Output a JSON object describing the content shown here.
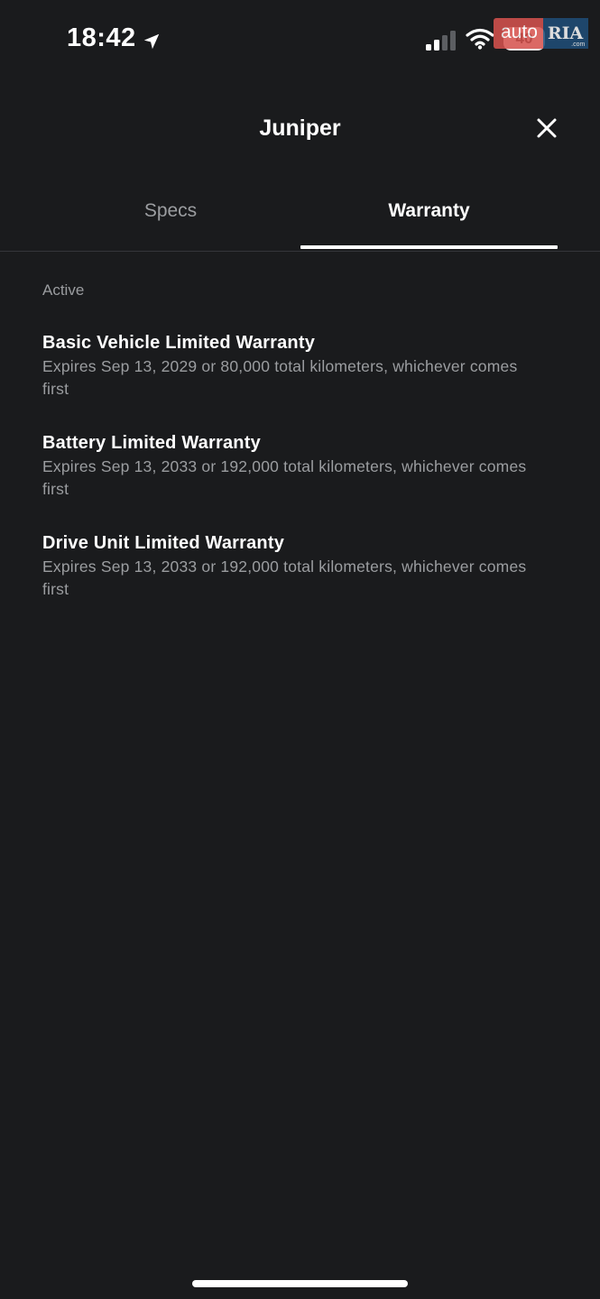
{
  "status_bar": {
    "time": "18:42",
    "battery": "40"
  },
  "watermark": {
    "auto": "auto",
    "ria": "RIA",
    "com": ".com"
  },
  "header": {
    "title": "Juniper"
  },
  "tabs": [
    {
      "label": "Specs",
      "active": false
    },
    {
      "label": "Warranty",
      "active": true
    }
  ],
  "warranty": {
    "section_label": "Active",
    "items": [
      {
        "title": "Basic Vehicle Limited Warranty",
        "description": "Expires Sep 13, 2029 or 80,000 total kilometers, whichever comes first"
      },
      {
        "title": "Battery Limited Warranty",
        "description": "Expires Sep 13, 2033 or 192,000 total kilometers, whichever comes first"
      },
      {
        "title": "Drive Unit Limited Warranty",
        "description": "Expires Sep 13, 2033 or 192,000 total kilometers, whichever comes first"
      }
    ]
  },
  "colors": {
    "background": "#1a1b1d",
    "text_primary": "#ffffff",
    "text_secondary": "#9b9da0",
    "divider": "#34363a"
  },
  "icons": {
    "location": "location-arrow-icon",
    "signal": "cellular-signal-icon",
    "wifi": "wifi-icon",
    "close": "close-icon"
  }
}
